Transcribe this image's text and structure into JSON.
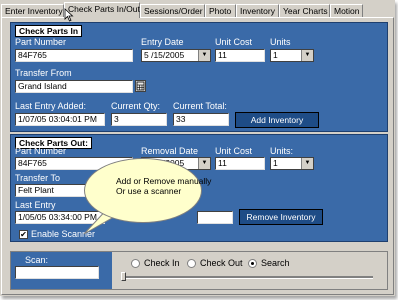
{
  "tabs": [
    {
      "label": "Enter Inventory"
    },
    {
      "label": "Check Parts In/Out"
    },
    {
      "label": "Sessions/Order"
    },
    {
      "label": "Photo"
    },
    {
      "label": "Inventory"
    },
    {
      "label": "Year Charts"
    },
    {
      "label": "Motion"
    }
  ],
  "active_tab": "Check Parts In/Out",
  "check_in": {
    "header": "Check Parts In",
    "part_number_label": "Part Number",
    "part_number_value": "84F765",
    "entry_date_label": "Entry Date",
    "entry_date_value": "5 /15/2005",
    "unit_cost_label": "Unit Cost",
    "unit_cost_value": "11",
    "units_label": "Units",
    "units_value": "1",
    "transfer_from_label": "Transfer From",
    "transfer_from_value": "Grand Island",
    "last_entry_label": "Last Entry Added:",
    "last_entry_value": "1/07/05  03:04:01 PM",
    "current_qty_label": "Current Qty:",
    "current_qty_value": "3",
    "current_total_label": "Current Total:",
    "current_total_value": "33",
    "add_button": "Add Inventory"
  },
  "check_out": {
    "header": "Check Parts Out:",
    "part_number_label": "Part Number",
    "part_number_value": "84F765",
    "removal_date_label": "Removal Date",
    "removal_date_value": "5 /15/2005",
    "unit_cost_label": "Unit Cost",
    "unit_cost_value": "11",
    "units_label": "Units:",
    "units_value": "1",
    "transfer_to_label": "Transfer To",
    "transfer_to_value": "Felt Plant",
    "last_entry_label": "Last Entry",
    "last_entry_value": "1/05/05  03:34:00 PM",
    "remove_button": "Remove Inventory",
    "scanner_label": "Enable Scanner",
    "scanner_checked": "✔"
  },
  "callout": {
    "line1": "Add or Remove manually",
    "line2": "Or use a scanner"
  },
  "scan": {
    "label": "Scan:",
    "value": ""
  },
  "mode": {
    "options": [
      "Check In",
      "Check Out",
      "Search"
    ],
    "selected": "Search"
  },
  "colors": {
    "panel": "#3a6aa8",
    "button": "#1e4c86",
    "window": "#d4d0c8",
    "callout": "#ffffcc"
  }
}
